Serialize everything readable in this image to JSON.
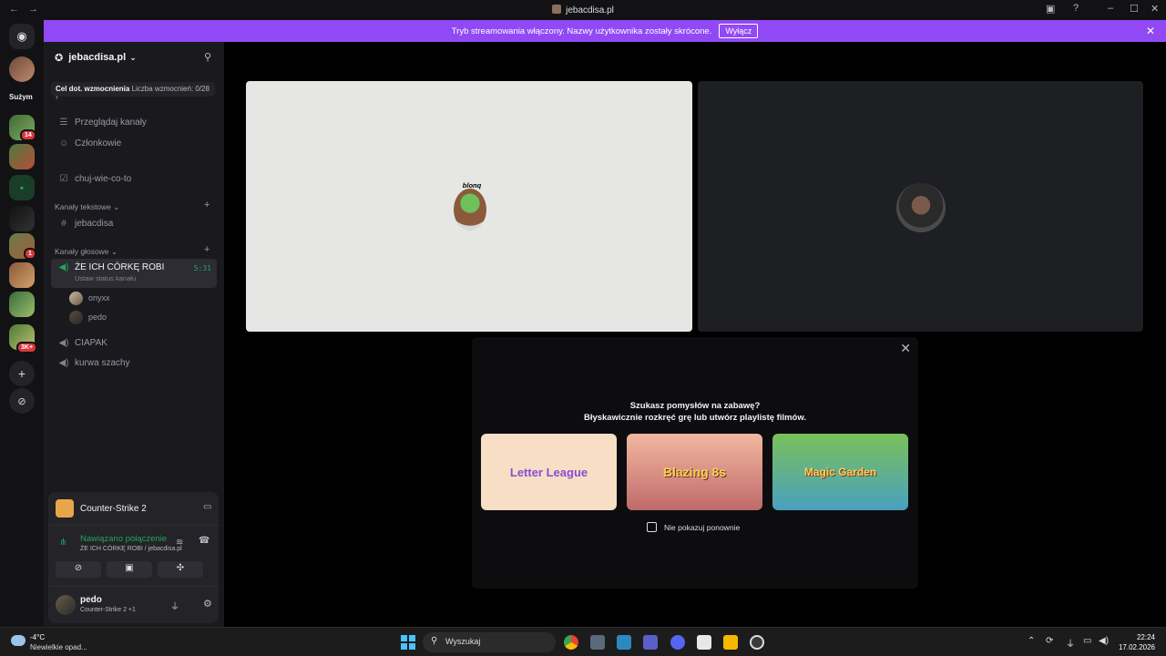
{
  "window": {
    "title": "jebacdisa.pl",
    "nav_back": "←",
    "nav_forward": "→"
  },
  "banner": {
    "text": "Tryb streamowania włączony. Nazwy użytkownika zostały skrócone.",
    "button": "Wyłącz",
    "close": "✕"
  },
  "servers": {
    "dm_tooltip_label": "Sużym",
    "badges": [
      "14",
      "1",
      "3K+"
    ]
  },
  "sidebar": {
    "guild_name": "jebacdisa.pl",
    "boost_goal": "Cel dot. wzmocnienia",
    "boost_count": "Liczba wzmocnień: 0/28",
    "browse": "Przeglądaj kanały",
    "members": "Członkowie",
    "pinned_channel": "chuj-wie-co-to",
    "text_category": "Kanały tekstowe",
    "text_channels": [
      "jebacdisa"
    ],
    "voice_category": "Kanały głosowe",
    "active_voice": {
      "name": "ŻE ICH CÓRKĘ ROBI",
      "timer": "5:31",
      "status": "Ustaw status kanału"
    },
    "voice_users": [
      "onyxx",
      "pedo"
    ],
    "other_voice": [
      "CIAPAK",
      "kurwa szachy"
    ]
  },
  "panel": {
    "activity": "Counter-Strike 2",
    "connection_status": "Nawiązano połączenie",
    "connection_detail": "ŻE ICH CÓRKĘ ROBI / jebacdisa.pl",
    "username": "pedo",
    "user_activity": "Counter-Strike 2 +1"
  },
  "stage": {
    "tile1_label": "blonq"
  },
  "popup": {
    "question": "Szukasz pomysłów na zabawę?",
    "subtitle": "Błyskawicznie rozkręć grę lub utwórz playlistę filmów.",
    "games": [
      "Letter League",
      "Blazing 8s",
      "Magic Garden"
    ],
    "dont_show": "Nie pokazuj ponownie"
  },
  "taskbar": {
    "weather_temp": "-4°C",
    "weather_desc": "Niewielkie opad...",
    "search": "Wyszukaj",
    "time": "22:24",
    "date": "17.02.2026"
  }
}
